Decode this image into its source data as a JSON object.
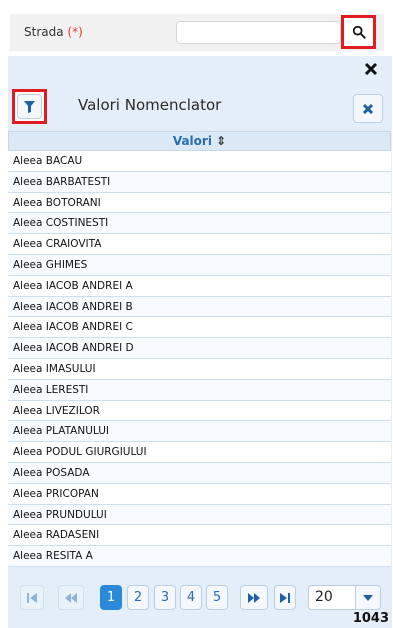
{
  "form": {
    "street_label": "Strada",
    "required_mark": "(*)",
    "street_value": ""
  },
  "dialog": {
    "title": "Valori Nomenclator",
    "column_header": "Valori",
    "sort_glyph": "⇕"
  },
  "rows": [
    "Aleea BACAU",
    "Aleea BARBATESTI",
    "Aleea BOTORANI",
    "Aleea COSTINESTI",
    "Aleea CRAIOVITA",
    "Aleea GHIMES",
    "Aleea IACOB ANDREI A",
    "Aleea IACOB ANDREI B",
    "Aleea IACOB ANDREI C",
    "Aleea IACOB ANDREI D",
    "Aleea IMASULUI",
    "Aleea LERESTI",
    "Aleea LIVEZILOR",
    "Aleea PLATANULUI",
    "Aleea PODUL GIURGIULUI",
    "Aleea POSADA",
    "Aleea PRICOPAN",
    "Aleea PRUNDULUI",
    "Aleea RADASENI",
    "Aleea RESITA A"
  ],
  "pager": {
    "pages": [
      "1",
      "2",
      "3",
      "4",
      "5"
    ],
    "current_page": "1",
    "page_size": "20",
    "total": "1043"
  },
  "icons": {
    "search": "search-icon",
    "close": "close-icon",
    "filter": "filter-icon",
    "first": "first-page-icon",
    "prev": "prev-page-icon",
    "next": "next-page-icon",
    "last": "last-page-icon",
    "caret": "caret-down-icon"
  },
  "colors": {
    "highlight": "#e01b22",
    "accent": "#2a8ad9",
    "panel": "#e3eef8"
  }
}
